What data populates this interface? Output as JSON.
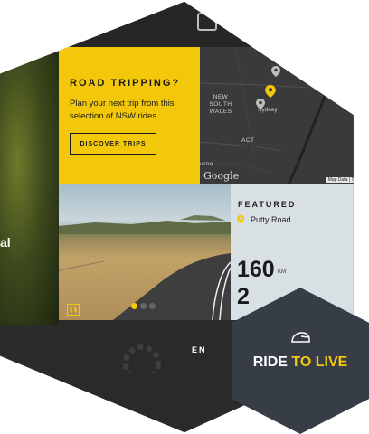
{
  "side": {
    "partial_text": "al"
  },
  "promo": {
    "heading": "ROAD TRIPPING?",
    "intro": "Plan your next trip from this selection of NSW rides.",
    "button_label": "DISCOVER TRIPS"
  },
  "map": {
    "labels": {
      "nsw": "NEW SOUTH WALES",
      "act": "ACT",
      "sydney": "Sydney",
      "partial_urne": "urne"
    },
    "google": "Google",
    "map_data": "Map Data",
    "terms": "Terms"
  },
  "featured": {
    "label": "FEATURED",
    "road": "Putty Road",
    "distance": "160",
    "unit": "KM",
    "second_value": "2"
  },
  "carousel": {
    "pause_icon": "pause-icon",
    "active_slide": 1,
    "slides": 3
  },
  "bottom": {
    "partial_text": "EN"
  },
  "badge": {
    "part1": "RIDE ",
    "part2": "TO LIVE"
  },
  "colors": {
    "accent": "#f4c80a",
    "dark": "#2b2b2b",
    "badge": "#363d47"
  }
}
